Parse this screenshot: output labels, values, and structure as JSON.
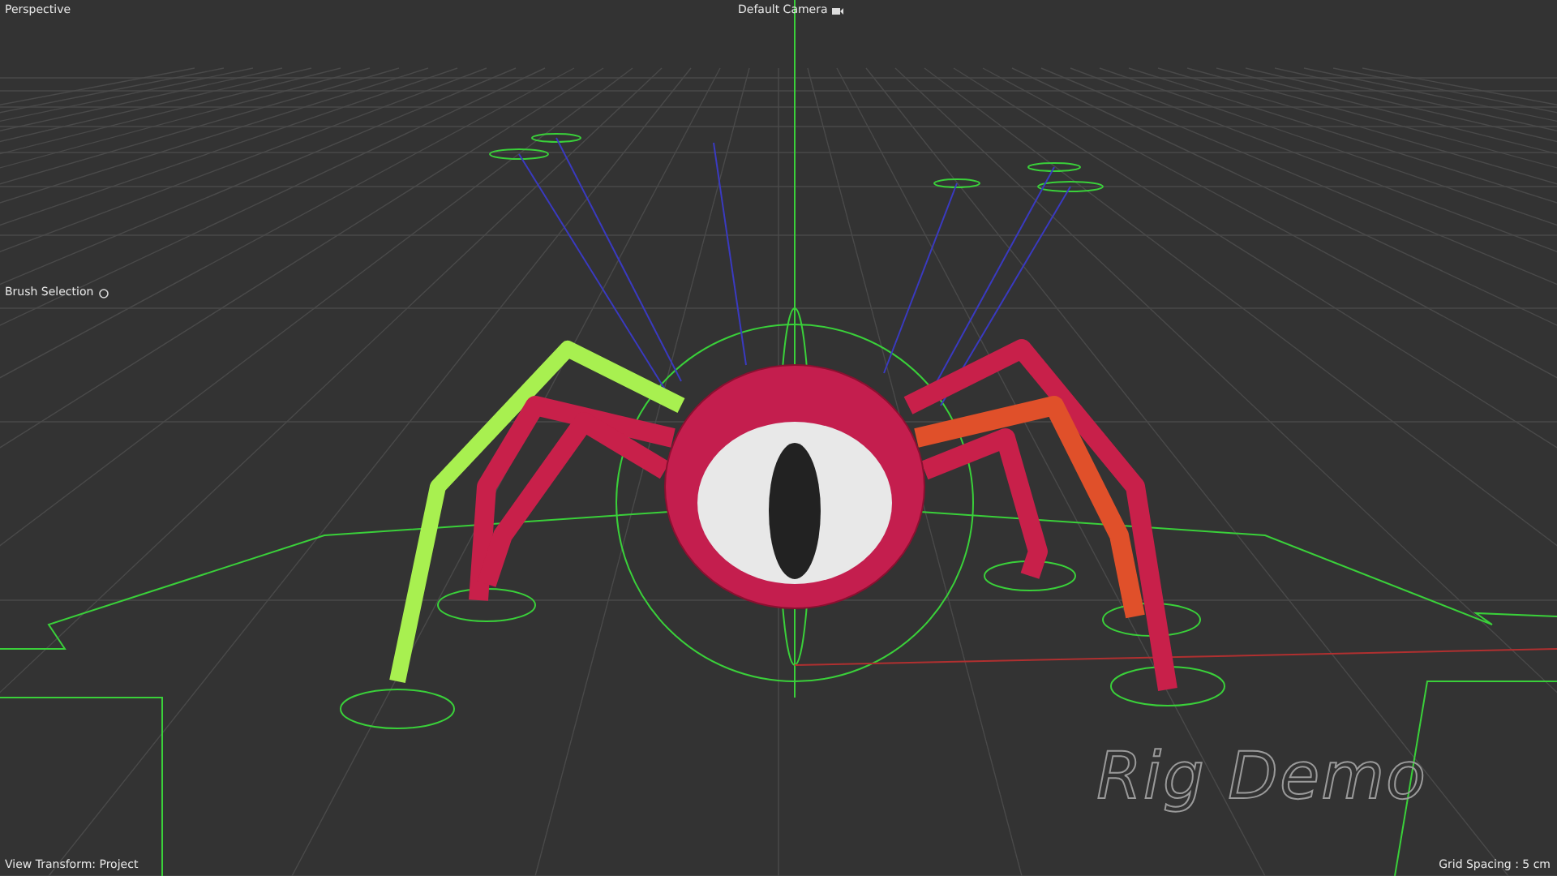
{
  "viewport": {
    "view_name": "Perspective",
    "camera": "Default Camera",
    "mode_label": "Brush Selection",
    "view_transform": "View Transform: Project",
    "grid_spacing": "Grid Spacing : 5 cm",
    "overlay_title": "Rig Demo"
  }
}
